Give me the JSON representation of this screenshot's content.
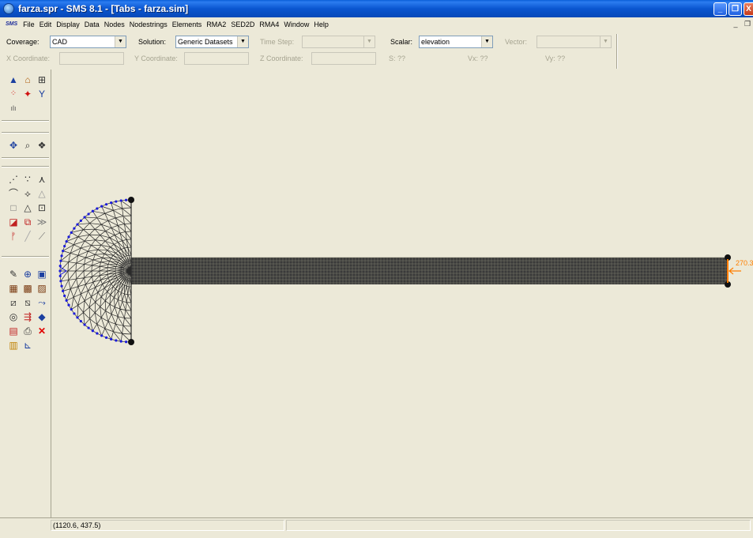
{
  "window": {
    "title": "farza.spr - SMS 8.1 - [Tabs - farza.sim]",
    "minimize_glyph": "_",
    "restore_glyph": "❐",
    "close_glyph": "X"
  },
  "menu": {
    "logo": "SMS",
    "items": [
      "File",
      "Edit",
      "Display",
      "Data",
      "Nodes",
      "Nodestrings",
      "Elements",
      "RMA2",
      "SED2D",
      "RMA4",
      "Window",
      "Help"
    ],
    "mdi_minimize": "_",
    "mdi_restore": "❐"
  },
  "toolbar": {
    "coverage_label": "Coverage:",
    "coverage_value": "CAD",
    "solution_label": "Solution:",
    "solution_value": "Generic Datasets",
    "timestep_label": "Time Step:",
    "timestep_value": "",
    "scalar_label": "Scalar:",
    "scalar_value": "elevation",
    "vector_label": "Vector:",
    "vector_value": "",
    "x_label": "X Coordinate:",
    "y_label": "Y Coordinate:",
    "z_label": "Z Coordinate:",
    "s_readout": "S: ??",
    "vx_readout": "Vx: ??",
    "vy_readout": "Vy: ??",
    "dropdown_glyph": "▼"
  },
  "palette": {
    "icons": [
      "select-mesh-icon",
      "select-house-icon",
      "select-grid-icon",
      "scatter-points-icon",
      "feature-points-icon",
      "nodestring-icon",
      "terrain-icon",
      "pan-icon",
      "zoom-icon",
      "rotate-icon",
      "select-node-icon",
      "select-nodes-icon",
      "select-element-icon",
      "create-arc-icon",
      "create-polygon-icon",
      "triangle-icon",
      "rectangle-icon",
      "triangle-outline-icon",
      "quad-icon",
      "merge-icon",
      "split-icon",
      "swap-icon",
      "nodestring-create-icon",
      "line-icon",
      "line-alt-icon",
      "edit-icon",
      "target-icon",
      "frame-icon",
      "assign-bc-icon",
      "assign-bc2-icon",
      "assign-bc3-icon",
      "dataset-icon",
      "dataset2-icon",
      "dataset3-icon",
      "contour-icon",
      "vector-icon",
      "layers-icon",
      "calculator-icon",
      "print-icon",
      "delete-icon",
      "plot-icon",
      "chart-icon"
    ]
  },
  "canvas": {
    "edge_label": "270.3",
    "colors": {
      "mesh": "#2a2a2a",
      "boundary_nodes": "#1a1adc",
      "corner_nodes": "#111111",
      "flow_bc": "#ff7f00"
    }
  },
  "status": {
    "cursor_readout": "(1120.6, 437.5)",
    "message": ""
  }
}
